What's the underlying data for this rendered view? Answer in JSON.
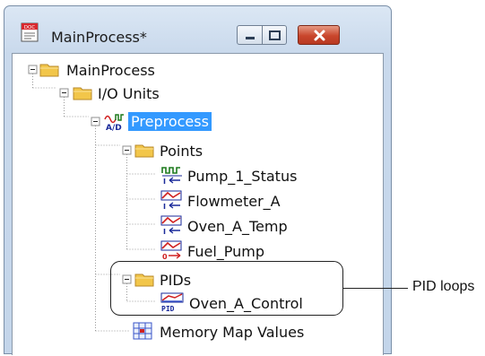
{
  "window": {
    "title": "MainProcess*"
  },
  "tree": {
    "root": "MainProcess",
    "io_units": "I/O Units",
    "preprocess": "Preprocess",
    "points": "Points",
    "point_items": [
      "Pump_1_Status",
      "Flowmeter_A",
      "Oven_A_Temp",
      "Fuel_Pump"
    ],
    "pids": "PIDs",
    "pid_items": [
      "Oven_A_Control"
    ],
    "memory_map": "Memory Map Values",
    "selected": "Preprocess"
  },
  "annotation": {
    "label": "PID loops"
  },
  "icons": {
    "window": "doc-icon",
    "folder": "folder-icon",
    "io_unit": "ad-io-unit-icon",
    "digital_in": "digital-input-icon",
    "analog_in": "analog-input-icon",
    "analog_out": "analog-output-icon",
    "pid": "pid-loop-icon",
    "memory_map": "memory-map-icon"
  },
  "colors": {
    "selection": "#3399ff",
    "folder": "#f2c64a",
    "close_button": "#c9462c"
  }
}
